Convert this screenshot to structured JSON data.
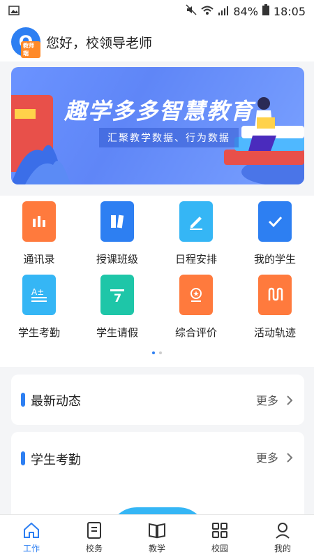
{
  "status": {
    "battery": "84%",
    "time": "18:05"
  },
  "header": {
    "greeting": "您好，校领导老师",
    "logo_tag": "教师端"
  },
  "banner": {
    "title": "趣学多多智慧教育",
    "subtitle": "汇聚教学数据、行为数据"
  },
  "grid": [
    {
      "label": "通讯录",
      "color": "#ff7a3d",
      "icon": "contacts-icon"
    },
    {
      "label": "授课班级",
      "color": "#2d7ff2",
      "icon": "books-icon"
    },
    {
      "label": "日程安排",
      "color": "#35b6f5",
      "icon": "edit-icon"
    },
    {
      "label": "我的学生",
      "color": "#2d7ff2",
      "icon": "check-icon"
    },
    {
      "label": "学生考勤",
      "color": "#35b6f5",
      "icon": "attendance-icon"
    },
    {
      "label": "学生请假",
      "color": "#1ec6a8",
      "icon": "calendar-icon"
    },
    {
      "label": "综合评价",
      "color": "#ff7a3d",
      "icon": "award-icon"
    },
    {
      "label": "活动轨迹",
      "color": "#ff7a3d",
      "icon": "track-icon"
    }
  ],
  "cards": [
    {
      "title": "最新动态",
      "more": "更多"
    },
    {
      "title": "学生考勤",
      "more": "更多"
    }
  ],
  "tabs": [
    {
      "label": "工作",
      "icon": "home-icon",
      "active": true
    },
    {
      "label": "校务",
      "icon": "document-icon",
      "active": false
    },
    {
      "label": "教学",
      "icon": "book-icon",
      "active": false
    },
    {
      "label": "校园",
      "icon": "apps-icon",
      "active": false
    },
    {
      "label": "我的",
      "icon": "user-icon",
      "active": false
    }
  ]
}
